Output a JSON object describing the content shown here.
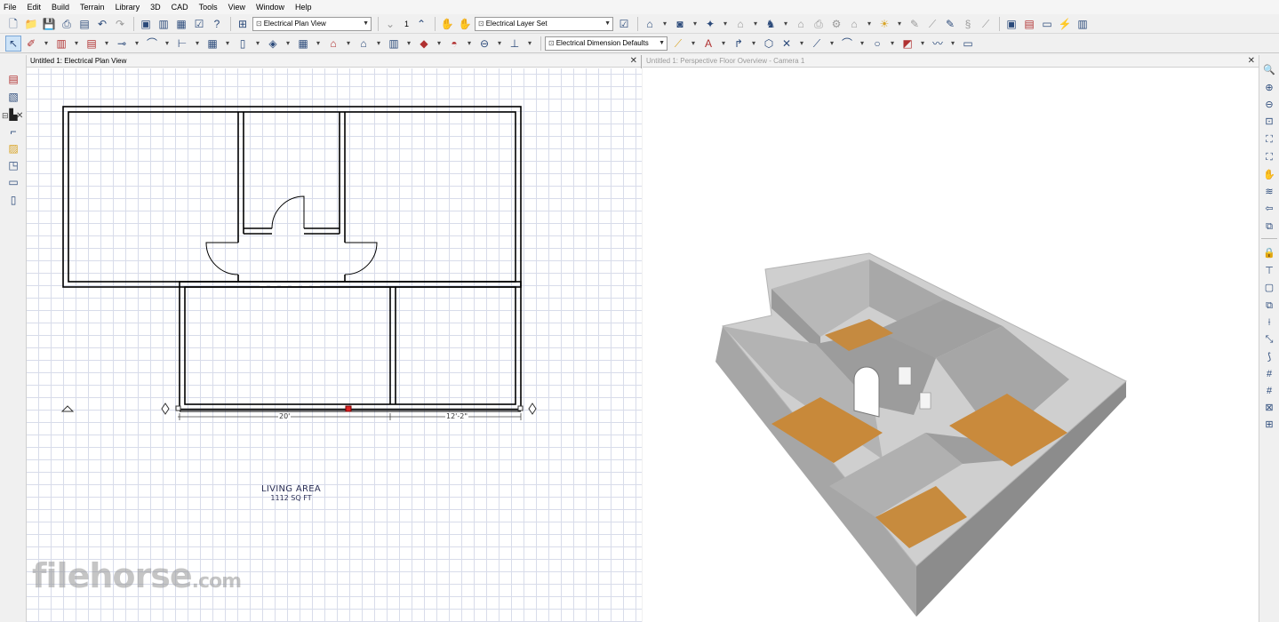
{
  "menu": [
    "File",
    "Edit",
    "Build",
    "Terrain",
    "Library",
    "3D",
    "CAD",
    "Tools",
    "View",
    "Window",
    "Help"
  ],
  "toolbar1": {
    "plan_view_combo": "Electrical Plan View",
    "floor_number": "1",
    "layer_set_combo": "Electrical Layer Set"
  },
  "toolbar2": {
    "dimension_defaults_combo": "Electrical Dimension Defaults"
  },
  "plan_pane": {
    "title": "Untitled 1: Electrical Plan View",
    "area_label": "LIVING AREA",
    "area_value": "1112 SQ FT",
    "dim_left": "20'",
    "dim_right": "12'-2\""
  },
  "view_pane": {
    "title": "Untitled 1: Perspective Floor Overview - Camera 1"
  },
  "watermark": {
    "brand": "filehorse",
    "domain": ".com"
  },
  "colors": {
    "wall_side": "#9e9e9e",
    "wall_top": "#c9c9c9",
    "floor": "#c98a3c",
    "grid": "#d8dcea",
    "plan_lines": "#000000"
  },
  "icons": {
    "toolbar1": [
      "new-file-icon",
      "open-folder-icon",
      "save-icon",
      "print-icon",
      "print-preview-icon",
      "undo-icon",
      "redo-icon",
      "select-objects-icon",
      "library-icon",
      "layer-display-icon",
      "default-settings-icon",
      "help-icon",
      "plan-view-icon",
      "previous-floor-icon",
      "next-floor-icon",
      "hand-pan-icon",
      "hand-alt-icon",
      "layer-properties-icon",
      "full-camera-icon",
      "camera-tools-icon",
      "view-tools-icon",
      "section-icon",
      "walls-icon",
      "roof-icon",
      "build-tools-icon",
      "electrical-icon",
      "light-icon",
      "pencil-icon",
      "eyedropper-icon",
      "material-painter-icon",
      "paint-icon",
      "window-tile-icon",
      "tile-vertical-icon",
      "tile-horizontal-icon",
      "cad-layout-icon"
    ],
    "toolbar2": [
      "select-arrow-icon",
      "edit-tool-icon",
      "railing-icon",
      "cabinet-icon",
      "electrical-outlet-icon",
      "stairs-icon",
      "framing-icon",
      "windows-icon",
      "doors-icon",
      "grid-icon",
      "roof-plane-icon",
      "terrain-icon",
      "shape-icon",
      "room-icon",
      "text-icon",
      "callout-icon",
      "arrow-icon",
      "line-icon",
      "arc-icon",
      "circle-icon",
      "spline-icon",
      "cad-block-icon",
      "dimension-icon",
      "ruler-icon",
      "text-style-icon",
      "callout-arrow-icon",
      "polyline-icon",
      "close-cad-icon",
      "line-tool-icon",
      "arc-tool-icon",
      "circle-tool-icon",
      "rectangle-tool-icon",
      "spline-tool-icon",
      "cad-file-icon"
    ],
    "left_tools": [
      "red-plan-icon",
      "green-plan-icon",
      "black-elevation-icon",
      "detail-icon",
      "yellow-plan-icon",
      "layout-icon",
      "wall-elevation-icon",
      "page-icon"
    ],
    "right_tools": [
      "zoom-icon",
      "zoom-in-icon",
      "zoom-out-icon",
      "zoom-box-icon",
      "fill-window-icon",
      "fill-all-icon",
      "pan-icon",
      "swap-view-icon",
      "back-view-icon",
      "forward-view-icon",
      "lock-icon",
      "dimension-line-icon",
      "rect-select-icon",
      "copy-icon",
      "temp-dim-icon",
      "snap-icon",
      "grid-snap-icon",
      "angle-snap-icon",
      "object-snap-icon",
      "ortho-icon"
    ]
  }
}
